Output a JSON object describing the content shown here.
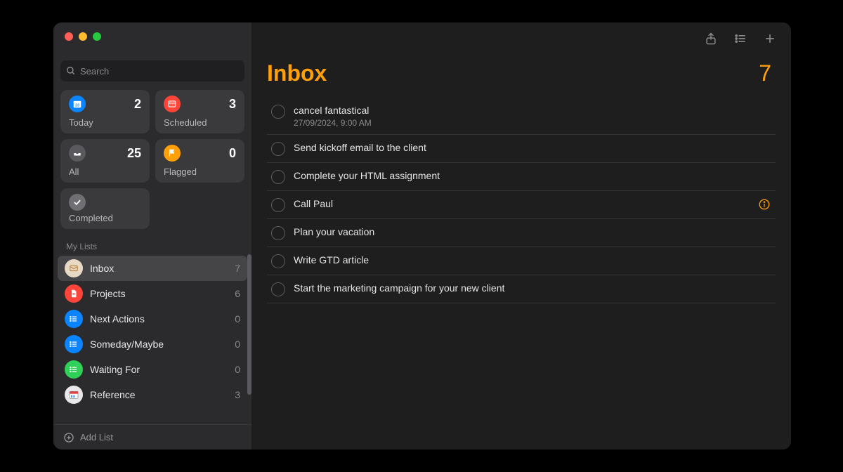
{
  "search": {
    "placeholder": "Search"
  },
  "smart": {
    "today": {
      "label": "Today",
      "count": "2"
    },
    "scheduled": {
      "label": "Scheduled",
      "count": "3"
    },
    "all": {
      "label": "All",
      "count": "25"
    },
    "flagged": {
      "label": "Flagged",
      "count": "0"
    },
    "completed": {
      "label": "Completed"
    }
  },
  "sections": {
    "mylists": "My Lists"
  },
  "lists": [
    {
      "name": "Inbox",
      "count": "7",
      "color": "li-beige",
      "icon": "envelope"
    },
    {
      "name": "Projects",
      "count": "6",
      "color": "li-red",
      "icon": "doc"
    },
    {
      "name": "Next Actions",
      "count": "0",
      "color": "li-blue",
      "icon": "list"
    },
    {
      "name": "Someday/Maybe",
      "count": "0",
      "color": "li-blue",
      "icon": "list"
    },
    {
      "name": "Waiting For",
      "count": "0",
      "color": "li-green",
      "icon": "list"
    },
    {
      "name": "Reference",
      "count": "3",
      "color": "li-ref",
      "icon": "ref"
    }
  ],
  "footer": {
    "addlist": "Add List"
  },
  "main": {
    "title": "Inbox",
    "count": "7"
  },
  "tasks": [
    {
      "title": "cancel fantastical",
      "sub": "27/09/2024, 9:00 AM",
      "info": false
    },
    {
      "title": "Send kickoff email to the client",
      "sub": "",
      "info": false
    },
    {
      "title": "Complete your HTML assignment",
      "sub": "",
      "info": false
    },
    {
      "title": "Call Paul",
      "sub": "",
      "info": true
    },
    {
      "title": "Plan your vacation",
      "sub": "",
      "info": false
    },
    {
      "title": "Write GTD article",
      "sub": "",
      "info": false
    },
    {
      "title": "Start the marketing campaign for your new client",
      "sub": "",
      "info": false
    }
  ]
}
